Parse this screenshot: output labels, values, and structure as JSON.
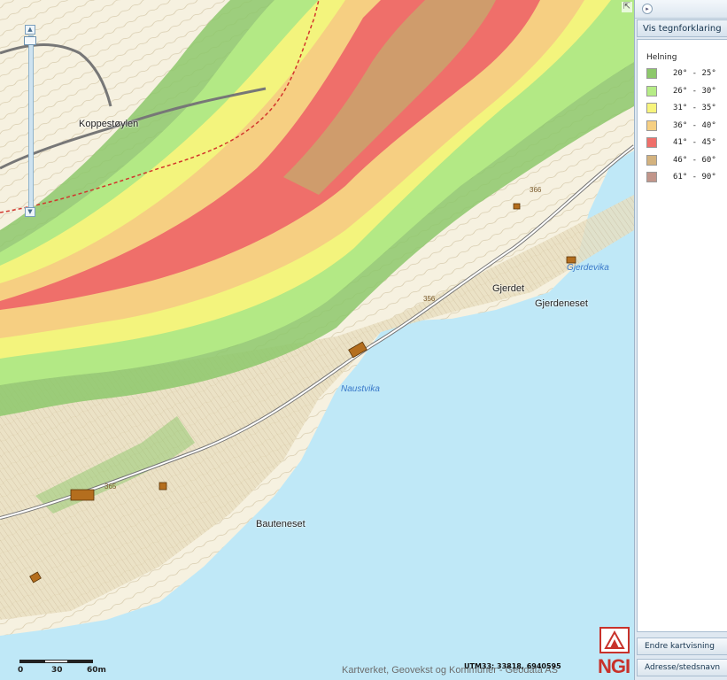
{
  "map": {
    "place_names": [
      "Koppestøylen",
      "Gjerdet",
      "Gjerdeneset",
      "Bauteneset"
    ],
    "water_names": [
      "Naustvika",
      "Gjerdevika"
    ],
    "elevations": [
      "366",
      "356",
      "365"
    ],
    "scale_labels": [
      "0",
      "30",
      "60m"
    ],
    "attribution": "Kartverket, Geovekst og Kommuner - Geodata AS",
    "coordinates": "UTM33: 33818, 6940595",
    "logo_text": "NGI",
    "colors": {
      "water": "#bfe8f7",
      "land": "#f6f1e0",
      "road": "#7f7f7f",
      "trail": "#d2352d"
    }
  },
  "panel": {
    "legend_button": "Vis tegnforklaring",
    "legend_title": "Helning",
    "legend_items": [
      {
        "label": "20° - 25°",
        "color": "#8dc86b"
      },
      {
        "label": "26° - 30°",
        "color": "#b6ec86"
      },
      {
        "label": "31° - 35°",
        "color": "#f7f47c"
      },
      {
        "label": "36° - 40°",
        "color": "#f6cf82"
      },
      {
        "label": "41° - 45°",
        "color": "#ef6f6a"
      },
      {
        "label": "46° - 60°",
        "color": "#d3b27e"
      },
      {
        "label": "61° - 90°",
        "color": "#c1958a"
      }
    ],
    "change_view_button": "Endre kartvisning",
    "address_button": "Adresse/stedsnavn"
  }
}
